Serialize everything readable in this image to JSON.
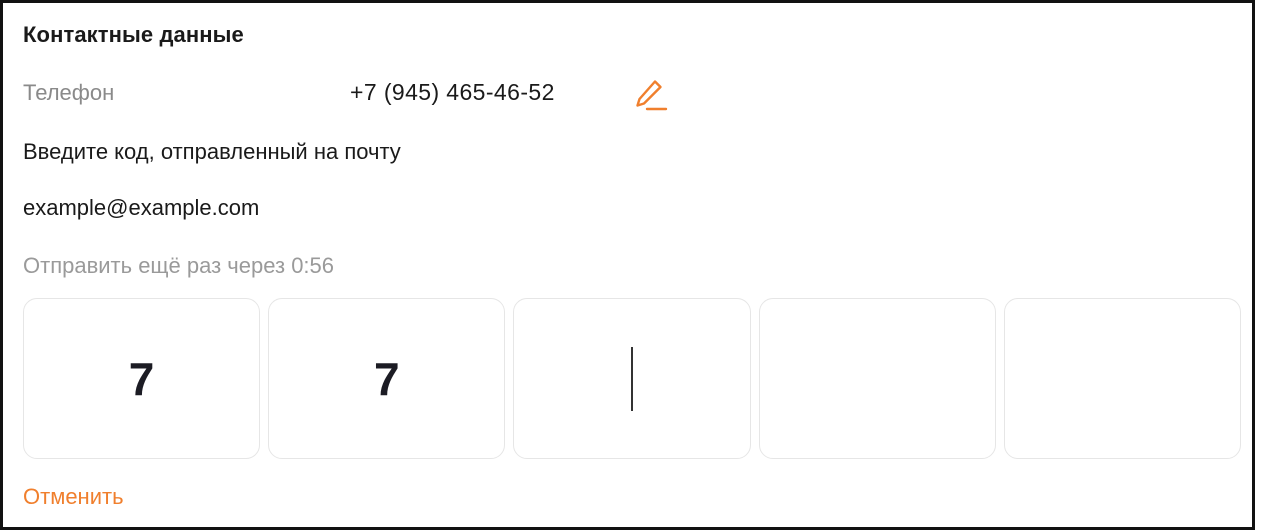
{
  "contacts": {
    "title": "Контактные данные",
    "phone": {
      "label": "Телефон",
      "value": "+7 (945) 465-46-52",
      "edit_icon": "pencil-icon"
    },
    "instruction": "Введите код, отправленный на почту",
    "email": "example@example.com",
    "resend_text": "Отправить ещё раз через 0:56",
    "code": {
      "digits": [
        "7",
        "7",
        "",
        "",
        ""
      ],
      "active_index": 2
    },
    "cancel_label": "Отменить"
  },
  "colors": {
    "accent": "#F07F2D",
    "text": "#1A1A1A",
    "muted": "#8A8A8A",
    "cell_border": "#E6E6E6"
  }
}
